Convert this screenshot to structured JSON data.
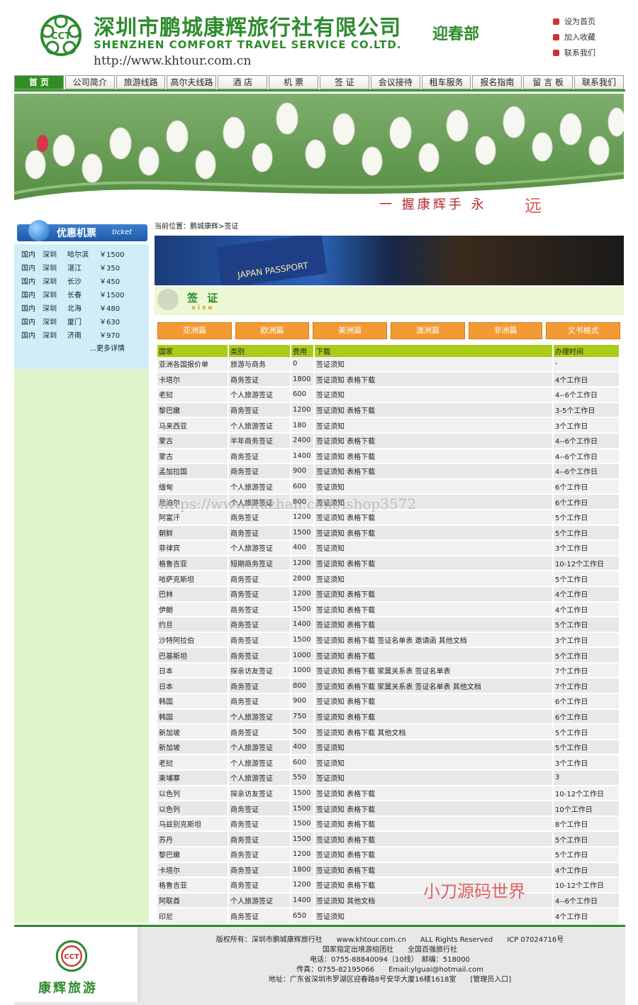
{
  "header": {
    "title_cn": "深圳市鹏城康辉旅行社有限公司",
    "title_sub": "迎春部",
    "title_en": "SHENZHEN COMFORT TRAVEL SERVICE CO.LTD.",
    "url": "http://www.khtour.com.cn",
    "logo_text": "CCT",
    "quick_links": [
      "设为首页",
      "加入收藏",
      "联系我们"
    ]
  },
  "nav": [
    "首 页",
    "公司简介",
    "旅游线路",
    "高尔夫线路",
    "酒 店",
    "机 票",
    "签 证",
    "会议接待",
    "租车服务",
    "报名指南",
    "留 言 板",
    "联系我们"
  ],
  "banner": {
    "slogan": "一 握康辉手 永",
    "slogan2": "远"
  },
  "sidebar": {
    "title": "优惠机票",
    "title_en": "ticket",
    "tickets": [
      [
        "国内",
        "深圳",
        "哈尔滨",
        "￥1500"
      ],
      [
        "国内",
        "深圳",
        "湛江",
        "￥350"
      ],
      [
        "国内",
        "深圳",
        "长沙",
        "￥450"
      ],
      [
        "国内",
        "深圳",
        "长春",
        "￥1500"
      ],
      [
        "国内",
        "深圳",
        "北海",
        "￥480"
      ],
      [
        "国内",
        "深圳",
        "厦门",
        "￥630"
      ],
      [
        "国内",
        "深圳",
        "济南",
        "￥970"
      ]
    ],
    "more": "...更多详情"
  },
  "main": {
    "breadcrumb": "当前位置：鹏城康辉>签证",
    "passport_text": "JAPAN PASSPORT",
    "section_title": "签 证",
    "section_en": "visa",
    "tabs": [
      "亚洲篇",
      "欧洲篇",
      "美洲篇",
      "澳洲篇",
      "非洲篇",
      "文书格式"
    ],
    "table_headers": [
      "国家",
      "类别",
      "费用",
      "下载",
      "办理时间"
    ],
    "rows": [
      [
        "亚洲各国报价单",
        "旅游与商务",
        "0",
        "签证须知",
        "-"
      ],
      [
        "卡塔尔",
        "商务签证",
        "1800",
        "签证须知 表格下载",
        "4个工作日"
      ],
      [
        "老挝",
        "个人旅游签证",
        "600",
        "签证须知",
        "4--6个工作日"
      ],
      [
        "黎巴嫩",
        "商务签证",
        "1200",
        "签证须知 表格下载",
        "3-5个工作日"
      ],
      [
        "马来西亚",
        "个人旅游签证",
        "180",
        "签证须知",
        "3个工作日"
      ],
      [
        "蒙古",
        "半年商务签证",
        "2400",
        "签证须知 表格下载",
        "4--6个工作日"
      ],
      [
        "蒙古",
        "商务签证",
        "1400",
        "签证须知 表格下载",
        "4--6个工作日"
      ],
      [
        "孟加拉国",
        "商务签证",
        "900",
        "签证须知 表格下载",
        "4--6个工作日"
      ],
      [
        "缅甸",
        "个人旅游签证",
        "600",
        "签证须知",
        "6个工作日"
      ],
      [
        "尼泊尔",
        "个人旅游签证",
        "800",
        "签证须知",
        "6个工作日"
      ],
      [
        "阿富汗",
        "商务签证",
        "1200",
        "签证须知 表格下载",
        "5个工作日"
      ],
      [
        "朝鲜",
        "商务签证",
        "1500",
        "签证须知 表格下载",
        "5个工作日"
      ],
      [
        "菲律宾",
        "个人旅游签证",
        "400",
        "签证须知",
        "3个工作日"
      ],
      [
        "格鲁吉亚",
        "短期商务签证",
        "1200",
        "签证须知 表格下载",
        "10-12个工作日"
      ],
      [
        "哈萨克斯坦",
        "商务签证",
        "2800",
        "签证须知",
        "5个工作日"
      ],
      [
        "巴林",
        "商务签证",
        "1200",
        "签证须知 表格下载",
        "4个工作日"
      ],
      [
        "伊朗",
        "商务签证",
        "1500",
        "签证须知 表格下载",
        "4个工作日"
      ],
      [
        "约旦",
        "商务签证",
        "1400",
        "签证须知 表格下载",
        "5个工作日"
      ],
      [
        "沙特阿拉伯",
        "商务签证",
        "1500",
        "签证须知 表格下载 签证名单表 邀请函 其他文档",
        "3个工作日"
      ],
      [
        "巴基斯坦",
        "商务签证",
        "1000",
        "签证须知 表格下载",
        "5个工作日"
      ],
      [
        "日本",
        "探亲访友签证",
        "1000",
        "签证须知 表格下载 家属关系表 签证名单表",
        "7个工作日"
      ],
      [
        "日本",
        "商务签证",
        "800",
        "签证须知 表格下载 家属关系表 签证名单表 其他文档",
        "7个工作日"
      ],
      [
        "韩国",
        "商务签证",
        "900",
        "签证须知 表格下载",
        "6个工作日"
      ],
      [
        "韩国",
        "个人旅游签证",
        "750",
        "签证须知 表格下载",
        "6个工作日"
      ],
      [
        "新加坡",
        "商务签证",
        "500",
        "签证须知 表格下载 其他文档",
        "5个工作日"
      ],
      [
        "新加坡",
        "个人旅游签证",
        "400",
        "签证须知",
        "5个工作日"
      ],
      [
        "老挝",
        "个人旅游签证",
        "600",
        "签证须知",
        "3个工作日"
      ],
      [
        "柬埔寨",
        "个人旅游签证",
        "550",
        "签证须知",
        "3"
      ],
      [
        "以色列",
        "探亲访友签证",
        "1500",
        "签证须知 表格下载",
        "10-12个工作日"
      ],
      [
        "以色列",
        "商务签证",
        "1500",
        "签证须知 表格下载",
        "10个工作日"
      ],
      [
        "乌兹别克斯坦",
        "商务签证",
        "1500",
        "签证须知 表格下载",
        "8个工作日"
      ],
      [
        "苏丹",
        "商务签证",
        "1500",
        "签证须知 表格下载",
        "5个工作日"
      ],
      [
        "黎巴嫩",
        "商务签证",
        "1200",
        "签证须知 表格下载",
        "5个工作日"
      ],
      [
        "卡塔尔",
        "商务签证",
        "1800",
        "签证须知 表格下载",
        "4个工作日"
      ],
      [
        "格鲁吉亚",
        "商务签证",
        "1200",
        "签证须知 表格下载",
        "10-12个工作日"
      ],
      [
        "阿联酋",
        "个人旅游签证",
        "1400",
        "签证须知 其他文档",
        "4--6个工作日"
      ],
      [
        "印尼",
        "商务签证",
        "650",
        "签证须知",
        "4个工作日"
      ]
    ]
  },
  "footer": {
    "brand": "康辉旅游",
    "lines": [
      "版权所有：深圳市鹏城康辉旅行社　　www.khtour.com.cn　　ALL Rights Reserved　　ICP 07024716号",
      "国家指定出境游组团社　　全国百强旅行社",
      "电话：0755-88840094（10线）　邮编：518000",
      "传真：0755-82195066　　Email:ylguai@hotmail.com",
      "地址：广东省深圳市罗湖区迎春路8号安华大厦16楼1618室　　[管理员入口]"
    ]
  },
  "watermarks": {
    "center": "https://www.huzhan.com/ishop3572",
    "corner": "小刀源码世界"
  }
}
